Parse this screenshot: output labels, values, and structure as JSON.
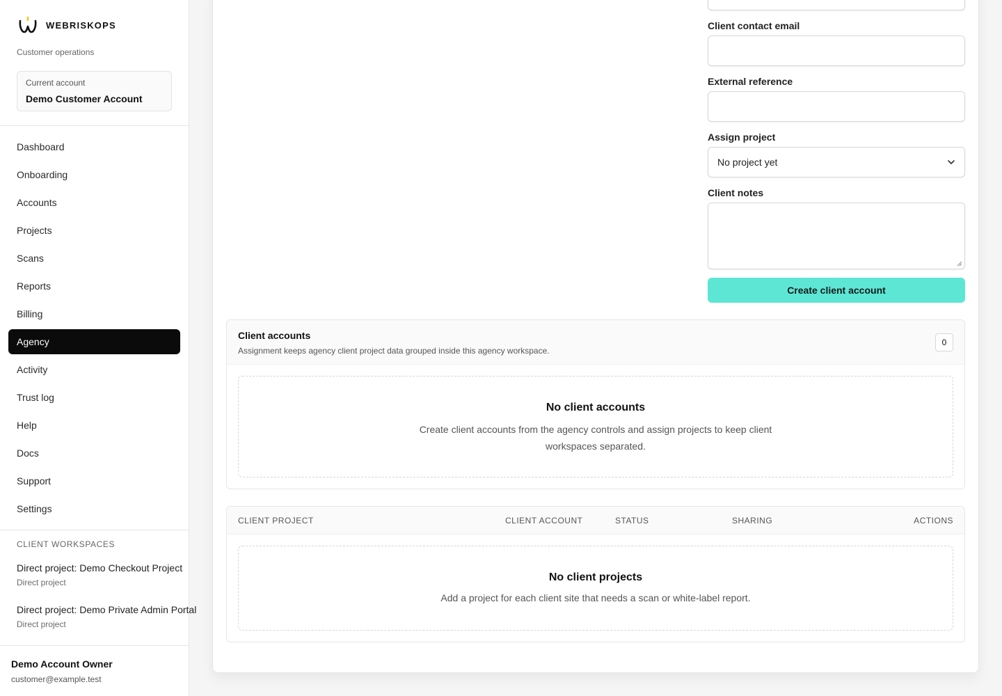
{
  "brand": {
    "name": "WEBRISKOPS",
    "subtitle": "Customer operations"
  },
  "account": {
    "label": "Current account",
    "name": "Demo Customer Account"
  },
  "nav": [
    {
      "label": "Dashboard",
      "active": false
    },
    {
      "label": "Onboarding",
      "active": false
    },
    {
      "label": "Accounts",
      "active": false
    },
    {
      "label": "Projects",
      "active": false
    },
    {
      "label": "Scans",
      "active": false
    },
    {
      "label": "Reports",
      "active": false
    },
    {
      "label": "Billing",
      "active": false
    },
    {
      "label": "Agency",
      "active": true
    },
    {
      "label": "Activity",
      "active": false
    },
    {
      "label": "Trust log",
      "active": false
    },
    {
      "label": "Help",
      "active": false
    },
    {
      "label": "Docs",
      "active": false
    },
    {
      "label": "Support",
      "active": false
    },
    {
      "label": "Settings",
      "active": false
    }
  ],
  "workspaces": {
    "title": "CLIENT WORKSPACES",
    "items": [
      {
        "title": "Direct project: Demo Checkout Project",
        "subtitle": "Direct project"
      },
      {
        "title": "Direct project: Demo Private Admin Portal",
        "subtitle": "Direct project"
      }
    ]
  },
  "owner": {
    "name": "Demo Account Owner",
    "email": "customer@example.test"
  },
  "form": {
    "email_label": "Client contact email",
    "email_value": "",
    "reference_label": "External reference",
    "reference_value": "",
    "project_label": "Assign project",
    "project_value": "No project yet",
    "notes_label": "Client notes",
    "notes_value": "",
    "submit_label": "Create client account"
  },
  "client_accounts": {
    "title": "Client accounts",
    "subtitle": "Assignment keeps agency client project data grouped inside this agency workspace.",
    "count": "0",
    "empty_title": "No client accounts",
    "empty_line1": "Create client accounts from the agency controls and assign projects to keep client",
    "empty_line2": "workspaces separated."
  },
  "projects_table": {
    "columns": [
      "CLIENT PROJECT",
      "CLIENT ACCOUNT",
      "STATUS",
      "SHARING",
      "ACTIONS"
    ],
    "empty_title": "No client projects",
    "empty_text": "Add a project for each client site that needs a scan or white-label report."
  },
  "colors": {
    "accent": "#5ee6d5",
    "active_nav": "#0b0b0b"
  }
}
